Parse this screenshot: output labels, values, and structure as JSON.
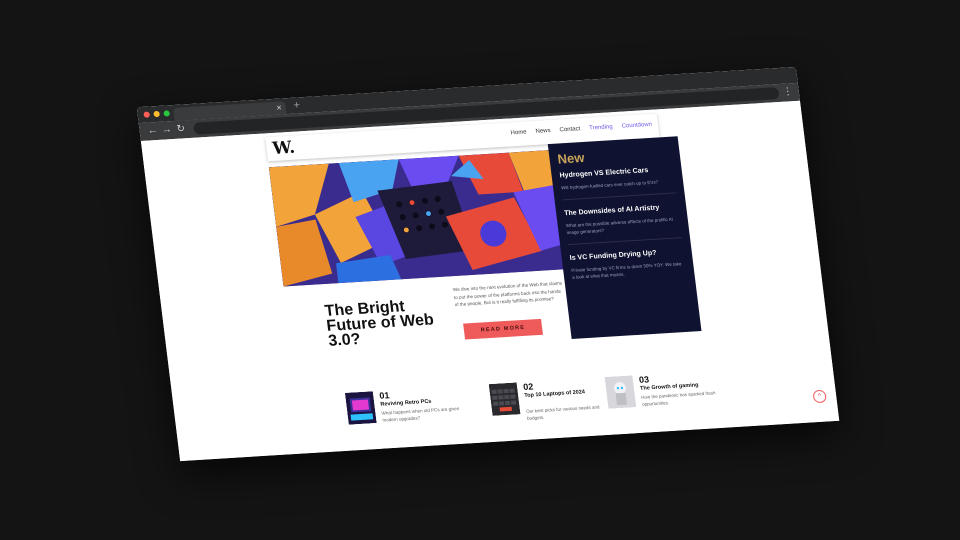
{
  "browser": {
    "tab_close": "×",
    "new_tab": "+",
    "back_icon": "←",
    "forward_icon": "→",
    "reload_icon": "↻",
    "menu_icon": "⋮"
  },
  "site": {
    "logo": "W.",
    "nav": [
      {
        "label": "Home",
        "highlight": false
      },
      {
        "label": "News",
        "highlight": false
      },
      {
        "label": "Contact",
        "highlight": false
      },
      {
        "label": "Trending",
        "highlight": true
      },
      {
        "label": "Countdown",
        "highlight": true
      }
    ]
  },
  "sidebar": {
    "heading": "New",
    "items": [
      {
        "title": "Hydrogen VS Electric Cars",
        "text": "Will hydrogen-fuelled cars ever catch up to EVs?"
      },
      {
        "title": "The Downsides of AI Artistry",
        "text": "What are the possible adverse effects of the prolific AI image generators?"
      },
      {
        "title": "Is VC Funding Drying Up?",
        "text": "Private funding by VC firms is down 50% YOY. We take a look at what that means."
      }
    ]
  },
  "main": {
    "headline": "The Bright Future of Web 3.0?",
    "lead": "We dive into the next evolution of the Web that claims to put the power of the platforms back into the hands of the people. But is it really fulfilling its promise?",
    "cta": "READ MORE"
  },
  "cards": [
    {
      "num": "01",
      "title": "Reviving Retro PCs",
      "desc": "What happens when old PCs are given modern upgrades?"
    },
    {
      "num": "02",
      "title": "Top 10 Laptops of 2024",
      "desc": "Our best picks for various needs and budgets."
    },
    {
      "num": "03",
      "title": "The Growth of gaming",
      "desc": "How the pandemic has sparked fresh opportunities."
    }
  ],
  "back_to_top": "^",
  "colors": {
    "accent": "#ef5a5a",
    "sidebar_bg": "#0f1230",
    "new_gold": "#c8a55a",
    "nav_highlight": "#6c5ce7"
  }
}
